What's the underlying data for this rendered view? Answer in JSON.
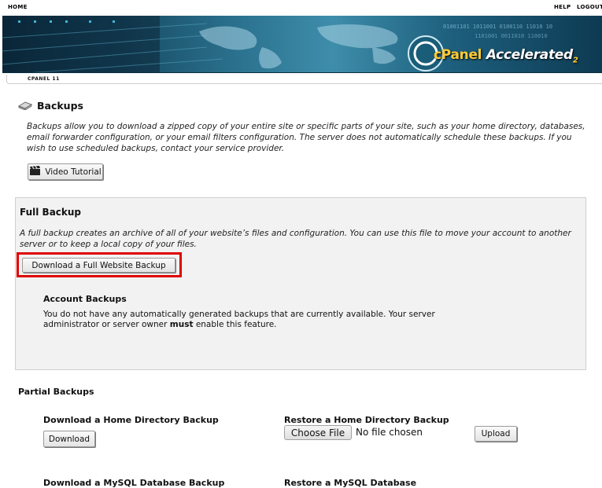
{
  "topnav": {
    "home": "HOME",
    "help": "HELP",
    "logout": "LOGOUT"
  },
  "banner": {
    "logo_c": "cPanel",
    "logo_rest": "Accelerated",
    "logo_sub": "2"
  },
  "version_label": "CPANEL 11",
  "page": {
    "title": "Backups",
    "intro": "Backups allow you to download a zipped copy of your entire site or specific parts of your site, such as your home directory, databases, email forwarder configuration, or your email filters configuration. The server does not automatically schedule these backups. If you wish to use scheduled backups, contact your service provider.",
    "video_button": "Video Tutorial"
  },
  "full_backup": {
    "title": "Full Backup",
    "description": "A full backup creates an archive of all of your website’s files and configuration. You can use this file to move your account to another server or to keep a local copy of your files.",
    "button": "Download a Full Website Backup",
    "highlight_color": "#e00000"
  },
  "account_backups": {
    "title": "Account Backups",
    "desc_part1": "You do not have any automatically generated backups that are currently available. Your server administrator or server owner ",
    "desc_bold": "must",
    "desc_part2": " enable this feature."
  },
  "partial": {
    "title": "Partial Backups",
    "home_download_title": "Download a Home Directory Backup",
    "download_button": "Download",
    "home_restore_title": "Restore a Home Directory Backup",
    "choose_file_button": "Choose File",
    "no_file_text": "No file chosen",
    "upload_button": "Upload",
    "mysql_download_title": "Download a MySQL Database Backup",
    "mysql_restore_title": "Restore a MySQL Database"
  },
  "icons": {
    "backup": "disk-tray-icon",
    "video": "clapperboard-icon"
  }
}
